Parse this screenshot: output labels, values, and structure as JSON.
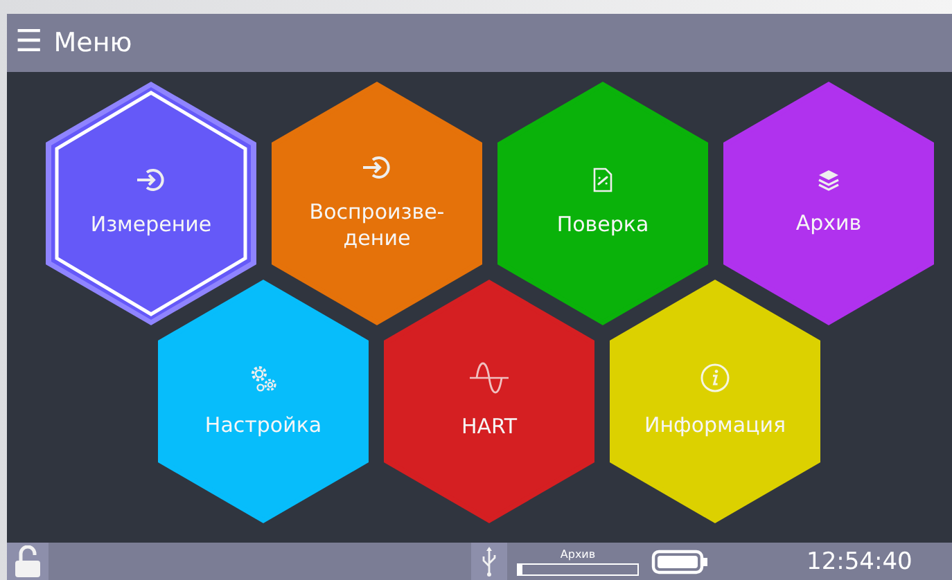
{
  "title_bar": {
    "menu_icon": "☰",
    "title": "Меню"
  },
  "tiles": [
    {
      "label": "Измерение",
      "color": "#6559f8",
      "selected": true
    },
    {
      "label": "Воспроизве-дение",
      "color": "#e5720a",
      "selected": false
    },
    {
      "label": "Поверка",
      "color": "#0ab20a",
      "selected": false
    },
    {
      "label": "Архив",
      "color": "#b032ee",
      "selected": false
    },
    {
      "label": "Настройка",
      "color": "#07bdfb",
      "selected": false
    },
    {
      "label": "HART",
      "color": "#d51f22",
      "selected": false
    },
    {
      "label": "Информация",
      "color": "#dcd100",
      "selected": false
    }
  ],
  "status_bar": {
    "archive": {
      "label": "Архив",
      "level": 0.03
    },
    "time": "12:54:40"
  }
}
